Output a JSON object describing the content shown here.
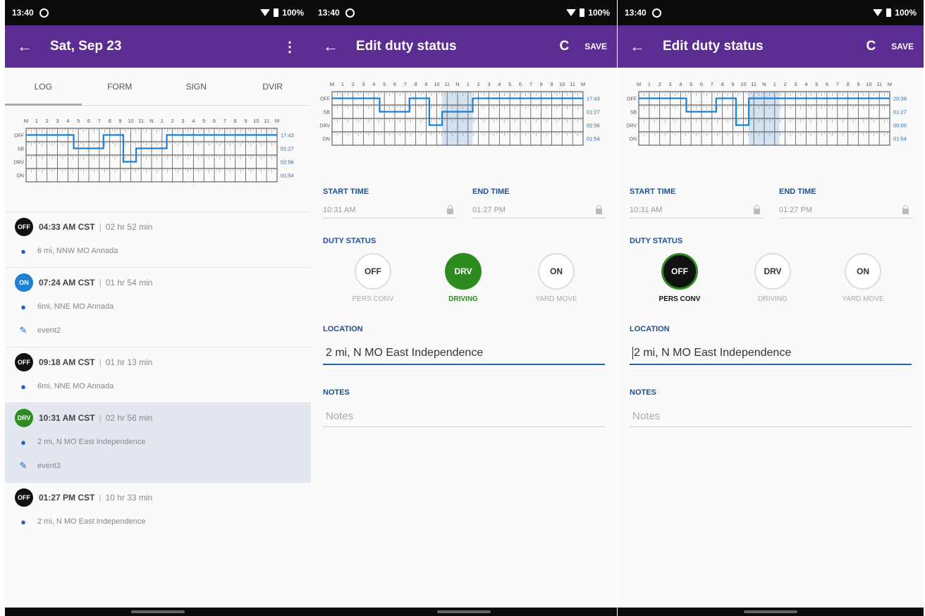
{
  "status_bar": {
    "time": "13:40",
    "battery": "100%"
  },
  "colors": {
    "appbar": "#5b2c91",
    "driving": "#2e8b1f",
    "on_duty": "#1f7fd1",
    "off_duty": "#111111",
    "chart_line": "#1f7fd1"
  },
  "grid": {
    "hour_labels": [
      "M",
      "1",
      "2",
      "3",
      "4",
      "5",
      "6",
      "7",
      "8",
      "9",
      "10",
      "11",
      "N",
      "1",
      "2",
      "3",
      "4",
      "5",
      "6",
      "7",
      "8",
      "9",
      "10",
      "11",
      "M"
    ],
    "row_labels": [
      "OFF",
      "SB",
      "DRV",
      "ON"
    ]
  },
  "screen1": {
    "title": "Sat, Sep 23",
    "back_icon": "arrow-left-icon",
    "menu_icon": "more-vert-icon",
    "tabs": [
      "LOG",
      "FORM",
      "SIGN",
      "DVIR"
    ],
    "totals": [
      "17:43",
      "01:27",
      "02:56",
      "01:54"
    ],
    "events": [
      {
        "badge": "OFF",
        "color": "#111111",
        "time": "04:33 AM CST",
        "duration": "02 hr 52 min",
        "location": "6 mi, NNW MO Annada",
        "note": ""
      },
      {
        "badge": "ON",
        "color": "#1f7fd1",
        "time": "07:24 AM CST",
        "duration": "01 hr 54 min",
        "location": "6mi, NNE MO Annada",
        "note": "event2"
      },
      {
        "badge": "OFF",
        "color": "#111111",
        "time": "09:18 AM CST",
        "duration": "01 hr 13 min",
        "location": "6mi, NNE MO Annada",
        "note": ""
      },
      {
        "badge": "DRV",
        "color": "#2e8b1f",
        "time": "10:31 AM CST",
        "duration": "02 hr 56 min",
        "location": "2 mi, N MO East Independence",
        "note": "event3",
        "selected": true
      },
      {
        "badge": "OFF",
        "color": "#111111",
        "time": "01:27 PM CST",
        "duration": "10 hr 33 min",
        "location": "2 mi, N MO East Independence",
        "note": ""
      }
    ]
  },
  "screen2": {
    "title": "Edit duty status",
    "refresh_label": "C",
    "save_label": "SAVE",
    "totals": [
      "17:43",
      "01:27",
      "02:56",
      "01:54"
    ],
    "start_time_label": "START TIME",
    "start_time": "10:31 AM",
    "end_time_label": "END TIME",
    "end_time": "01:27 PM",
    "duty_status_label": "DUTY STATUS",
    "options": [
      {
        "code": "OFF",
        "label": "PERS CONV"
      },
      {
        "code": "DRV",
        "label": "DRIVING",
        "selected": true
      },
      {
        "code": "ON",
        "label": "YARD MOVE"
      }
    ],
    "location_label": "LOCATION",
    "location": "2 mi, N MO East Independence",
    "notes_label": "NOTES",
    "notes_placeholder": "Notes"
  },
  "screen3": {
    "title": "Edit duty status",
    "refresh_label": "C",
    "save_label": "SAVE",
    "totals": [
      "20:39",
      "01:27",
      "00:00",
      "01:54"
    ],
    "start_time_label": "START TIME",
    "start_time": "10:31 AM",
    "end_time_label": "END TIME",
    "end_time": "01:27 PM",
    "duty_status_label": "DUTY STATUS",
    "options": [
      {
        "code": "OFF",
        "label": "PERS CONV",
        "selected": true
      },
      {
        "code": "DRV",
        "label": "DRIVING"
      },
      {
        "code": "ON",
        "label": "YARD MOVE"
      }
    ],
    "location_label": "LOCATION",
    "location": "2 mi, N MO East Independence",
    "notes_label": "NOTES",
    "notes_placeholder": "Notes"
  },
  "log_segments": {
    "screen1": [
      [
        0,
        4.55,
        "OFF"
      ],
      [
        4.55,
        7.4,
        "SB"
      ],
      [
        7.4,
        9.3,
        "OFF"
      ],
      [
        9.3,
        10.52,
        "DRV"
      ],
      [
        10.52,
        13.45,
        "SB"
      ],
      [
        13.45,
        24,
        "OFF"
      ]
    ],
    "screen2": [
      [
        0,
        4.55,
        "OFF"
      ],
      [
        4.55,
        7.4,
        "SB"
      ],
      [
        7.4,
        9.3,
        "OFF"
      ],
      [
        9.3,
        10.52,
        "DRV"
      ],
      [
        10.52,
        13.45,
        "SB"
      ],
      [
        13.45,
        24,
        "OFF"
      ]
    ],
    "screen3": [
      [
        0,
        4.55,
        "OFF"
      ],
      [
        4.55,
        7.4,
        "SB"
      ],
      [
        7.4,
        9.3,
        "OFF"
      ],
      [
        9.3,
        10.52,
        "DRV"
      ],
      [
        10.52,
        24,
        "OFF"
      ]
    ]
  },
  "highlight_range": [
    10.52,
    13.45
  ]
}
